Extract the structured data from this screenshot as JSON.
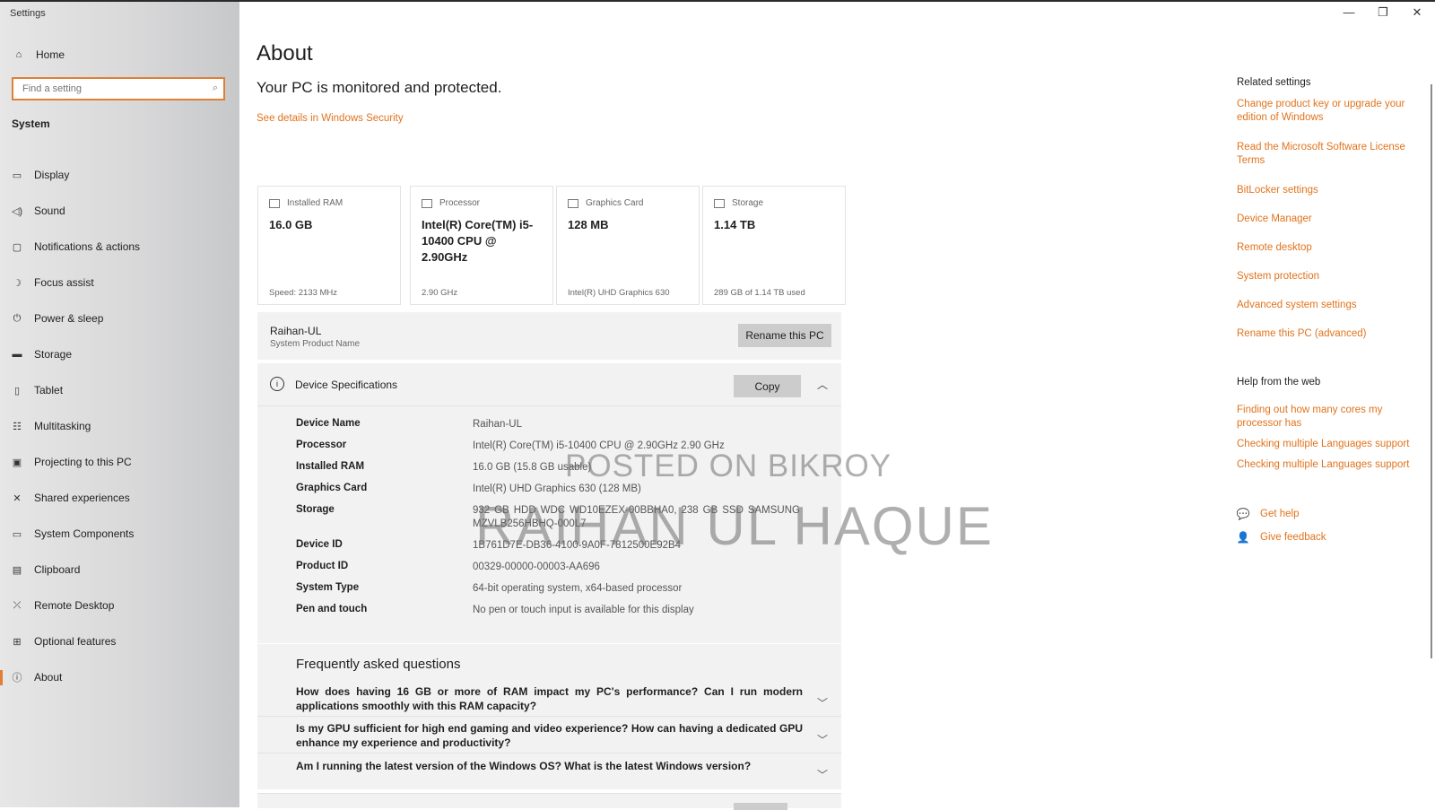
{
  "window": {
    "title": "Settings",
    "minimize": "—",
    "restore": "❐",
    "close": "✕"
  },
  "sidebar": {
    "home": "Home",
    "search_placeholder": "Find a setting",
    "section": "System",
    "items": [
      {
        "label": "Display",
        "icon": "display-icon"
      },
      {
        "label": "Sound",
        "icon": "sound-icon"
      },
      {
        "label": "Notifications & actions",
        "icon": "notifications-icon"
      },
      {
        "label": "Focus assist",
        "icon": "focus-assist-icon"
      },
      {
        "label": "Power & sleep",
        "icon": "power-icon"
      },
      {
        "label": "Storage",
        "icon": "storage-icon"
      },
      {
        "label": "Tablet",
        "icon": "tablet-icon"
      },
      {
        "label": "Multitasking",
        "icon": "multitasking-icon"
      },
      {
        "label": "Projecting to this PC",
        "icon": "projecting-icon"
      },
      {
        "label": "Shared experiences",
        "icon": "shared-experiences-icon"
      },
      {
        "label": "System Components",
        "icon": "system-components-icon"
      },
      {
        "label": "Clipboard",
        "icon": "clipboard-icon"
      },
      {
        "label": "Remote Desktop",
        "icon": "remote-desktop-icon"
      },
      {
        "label": "Optional features",
        "icon": "optional-features-icon"
      },
      {
        "label": "About",
        "icon": "about-icon",
        "active": true
      }
    ]
  },
  "main": {
    "title": "About",
    "status": "Your PC is monitored and protected.",
    "security_link": "See details in Windows Security",
    "cards": [
      {
        "label": "Installed RAM",
        "value": "16.0 GB",
        "foot": "Speed: 2133 MHz"
      },
      {
        "label": "Processor",
        "value": "Intel(R) Core(TM) i5-10400 CPU @ 2.90GHz",
        "foot": "2.90 GHz"
      },
      {
        "label": "Graphics Card",
        "value": "128 MB",
        "foot": "Intel(R) UHD Graphics 630"
      },
      {
        "label": "Storage",
        "value": "1.14 TB",
        "foot": "289 GB of 1.14 TB used"
      }
    ],
    "pc_name": "Raihan-UL",
    "pc_name_caption": "System Product Name",
    "rename_button": "Rename this PC",
    "specs": {
      "title": "Device Specifications",
      "copy_button": "Copy",
      "rows": [
        {
          "key": "Device Name",
          "value": "Raihan-UL"
        },
        {
          "key": "Processor",
          "value": "Intel(R) Core(TM) i5-10400 CPU @ 2.90GHz   2.90 GHz"
        },
        {
          "key": "Installed RAM",
          "value": "16.0 GB (15.8 GB usable)"
        },
        {
          "key": "Graphics Card",
          "value": "Intel(R) UHD Graphics 630 (128 MB)"
        },
        {
          "key": "Storage",
          "value": "932 GB HDD WDC WD10EZEX-00BBHA0, 238 GB SSD SAMSUNG MZVLB256HBHQ-000L7"
        },
        {
          "key": "Device ID",
          "value": "1B761D7E-DB36-4100-9A0F-7812500E92B4"
        },
        {
          "key": "Product ID",
          "value": "00329-00000-00003-AA696"
        },
        {
          "key": "System Type",
          "value": "64-bit operating system, x64-based processor"
        },
        {
          "key": "Pen and touch",
          "value": "No pen or touch input is available for this display"
        }
      ]
    },
    "faq": {
      "title": "Frequently asked questions",
      "items": [
        "How does having 16 GB or more of RAM impact my PC's performance? Can I run modern applications smoothly with this RAM capacity?",
        "Is my GPU sufficient for high end gaming and video experience? How can having a dedicated GPU enhance my experience and productivity?",
        "Am I running the latest version of the Windows OS? What is the latest Windows version?"
      ]
    }
  },
  "related": {
    "title": "Related settings",
    "links": [
      "Change product key or upgrade your edition of Windows",
      "Read the Microsoft Software License Terms",
      "BitLocker settings",
      "Device Manager",
      "Remote desktop",
      "System protection",
      "Advanced system settings",
      "Rename this PC (advanced)"
    ]
  },
  "web_help": {
    "title": "Help from the web",
    "links": [
      "Finding out how many cores my processor has",
      "Checking multiple Languages support",
      "Checking multiple Languages support"
    ],
    "get_help": "Get help",
    "give_feedback": "Give feedback"
  },
  "watermark": {
    "line1": "POSTED ON BIKROY",
    "line2": "RAIHAN UL HAQUE"
  },
  "colors": {
    "accent": "#e1731c",
    "sidebar_bg": "#d9d9da",
    "panel_bg": "#f2f2f2"
  }
}
